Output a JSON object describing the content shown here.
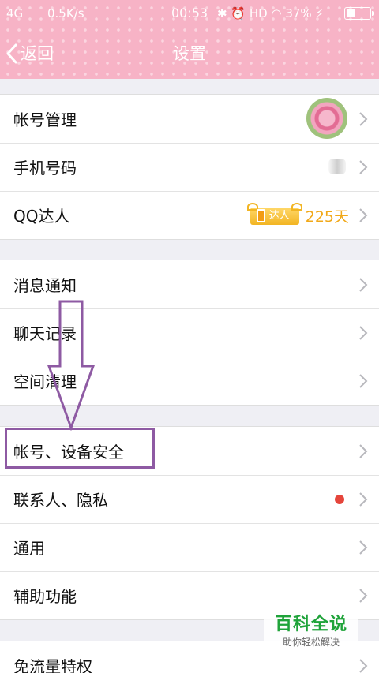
{
  "status_bar": {
    "network": "4G",
    "speed": "0.5K/s",
    "time": "00:53",
    "right": "HD",
    "battery": "37%"
  },
  "nav": {
    "back_label": "返回",
    "title": "设置"
  },
  "group1": [
    {
      "label": "帐号管理"
    },
    {
      "label": "手机号码"
    },
    {
      "label": "QQ达人",
      "badge_text": "达人",
      "days": "225天"
    }
  ],
  "group2": [
    {
      "label": "消息通知"
    },
    {
      "label": "聊天记录"
    },
    {
      "label": "空间清理"
    }
  ],
  "group3": [
    {
      "label": "帐号、设备安全"
    },
    {
      "label": "联系人、隐私"
    },
    {
      "label": "通用"
    },
    {
      "label": "辅助功能"
    }
  ],
  "group4": [
    {
      "label": "免流量特权"
    }
  ],
  "watermark": {
    "title": "百科全说",
    "subtitle": "助你轻松解决"
  },
  "colors": {
    "header": "#f7b3c6",
    "highlight": "#8e5aa3",
    "days": "#f1a818",
    "red_dot": "#e5453b",
    "watermark": "#1fa33a"
  }
}
